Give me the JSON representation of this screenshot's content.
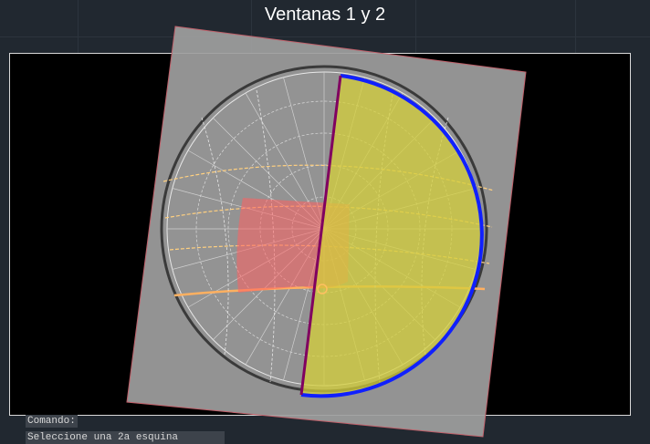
{
  "window": {
    "title": "Ventanas 1 y 2"
  },
  "command_line": {
    "label": "Comando:",
    "input_value": "Seleccione una 2a esquina"
  },
  "drawing": {
    "diagram": "sun-path",
    "colors": {
      "background": "#000000",
      "frame": "#d9d9d9",
      "overlay_fill": "#a0a0a0",
      "overlay_border": "#c0606a",
      "shade_window_1": "#ff8080",
      "shade_window_2": "#d4cf3a",
      "arc": "#1020ff",
      "divider": "#800060",
      "sun_path": "#ffc060"
    }
  }
}
